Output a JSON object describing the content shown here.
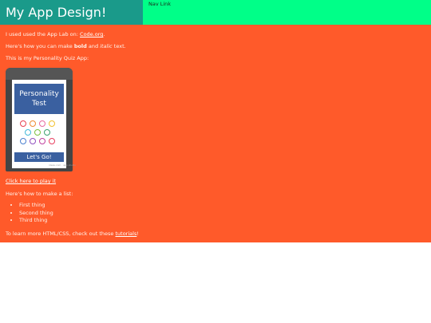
{
  "header": {
    "title": "My App Design!",
    "nav_link": "Nav Link"
  },
  "main": {
    "intro": {
      "before": "I used used the App Lab on: ",
      "link": "Code.org",
      "after": "."
    },
    "format": {
      "before": "Here's how you can make ",
      "bold": "bold",
      "middle": " and ",
      "italic": "italic",
      "after": " text."
    },
    "app_label": "This is my Personality Quiz App:",
    "app_image": {
      "title_line1": "Personality",
      "title_line2": "Test",
      "button": "Let's Go!",
      "footer": "ideas.com · app studio",
      "faces": [
        {
          "color": "#e84050"
        },
        {
          "color": "#f08a30"
        },
        {
          "color": "#e86aa0"
        },
        {
          "color": "#f2c230"
        },
        {
          "color": "#40b8d8"
        },
        {
          "color": "#7ac040"
        },
        {
          "color": "#3aa070"
        },
        {
          "color": "#4a80d0"
        },
        {
          "color": "#9050c0"
        },
        {
          "color": "#c040a0"
        },
        {
          "color": "#e84060"
        }
      ]
    },
    "play_link": "Click here to play it",
    "list_label": "Here's how to make a list:",
    "list_items": [
      "First thing",
      "Second thing",
      "Third thing"
    ],
    "learn": {
      "before": "To learn more HTML/CSS, check out these ",
      "link": "tutorials",
      "after": "!"
    }
  },
  "colors": {
    "header_left": "#1a9a8a",
    "header_right": "#00ff88",
    "main_bg": "#ff5a2a"
  }
}
